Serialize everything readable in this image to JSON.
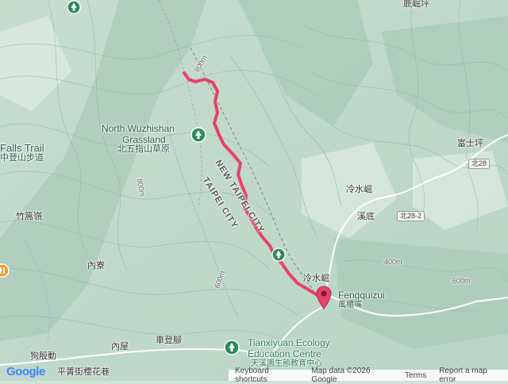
{
  "labels": {
    "north_wuzhishan_en_1": "North Wuzhishan",
    "north_wuzhishan_en_2": "Grassland",
    "north_wuzhishan_zh": "北五指山草原",
    "new_taipei_city": "NEW TAIPEI CITY",
    "taipei_city": "TAIPEI CITY",
    "falls_trail": "Falls Trail",
    "falls_trail_zh": "中登山步道",
    "zhugaoling": "竹篙嶺",
    "neiliao": "內寮",
    "neiwu": "內屋",
    "chedengjiao": "車登腳",
    "goudiandong": "狗殷動",
    "lengshuikeng": "冷水崛",
    "xidi": "溪底",
    "lengshuikeng2": "冷水崛",
    "fengquizui_en": "Fengquizui",
    "fengquizui_zh": "風櫃嘴",
    "fushiping": "富士坪",
    "lulujiaoping": "鹿崛坪",
    "tianxiyuan_1": "Tianxiyuan Ecology",
    "tianxiyuan_2": "Education Centre",
    "tianxiyuan_zh": "天溪園生態教育中心",
    "bottom_zh": "平菁街櫻花巷",
    "elev_400m": "400m",
    "elev_600m": "600m",
    "elev_600m_b": "600m",
    "elev_800m": "800m",
    "elev_800m_b": "800m"
  },
  "roads": {
    "north_28": "北28",
    "north_28_2": "北28-2"
  },
  "attribution": {
    "google": "Google",
    "keyboard": "Keyboard shortcuts",
    "map_data": "Map data ©2026 Google",
    "terms": "Terms",
    "report": "Report a map error"
  },
  "colors": {
    "track": "#e8416a",
    "park_icon": "#2e8b57",
    "terrain_base": "#cfe3d6"
  },
  "icons": [
    "park-icon",
    "destination-pin-icon",
    "orange-poi-icon"
  ]
}
